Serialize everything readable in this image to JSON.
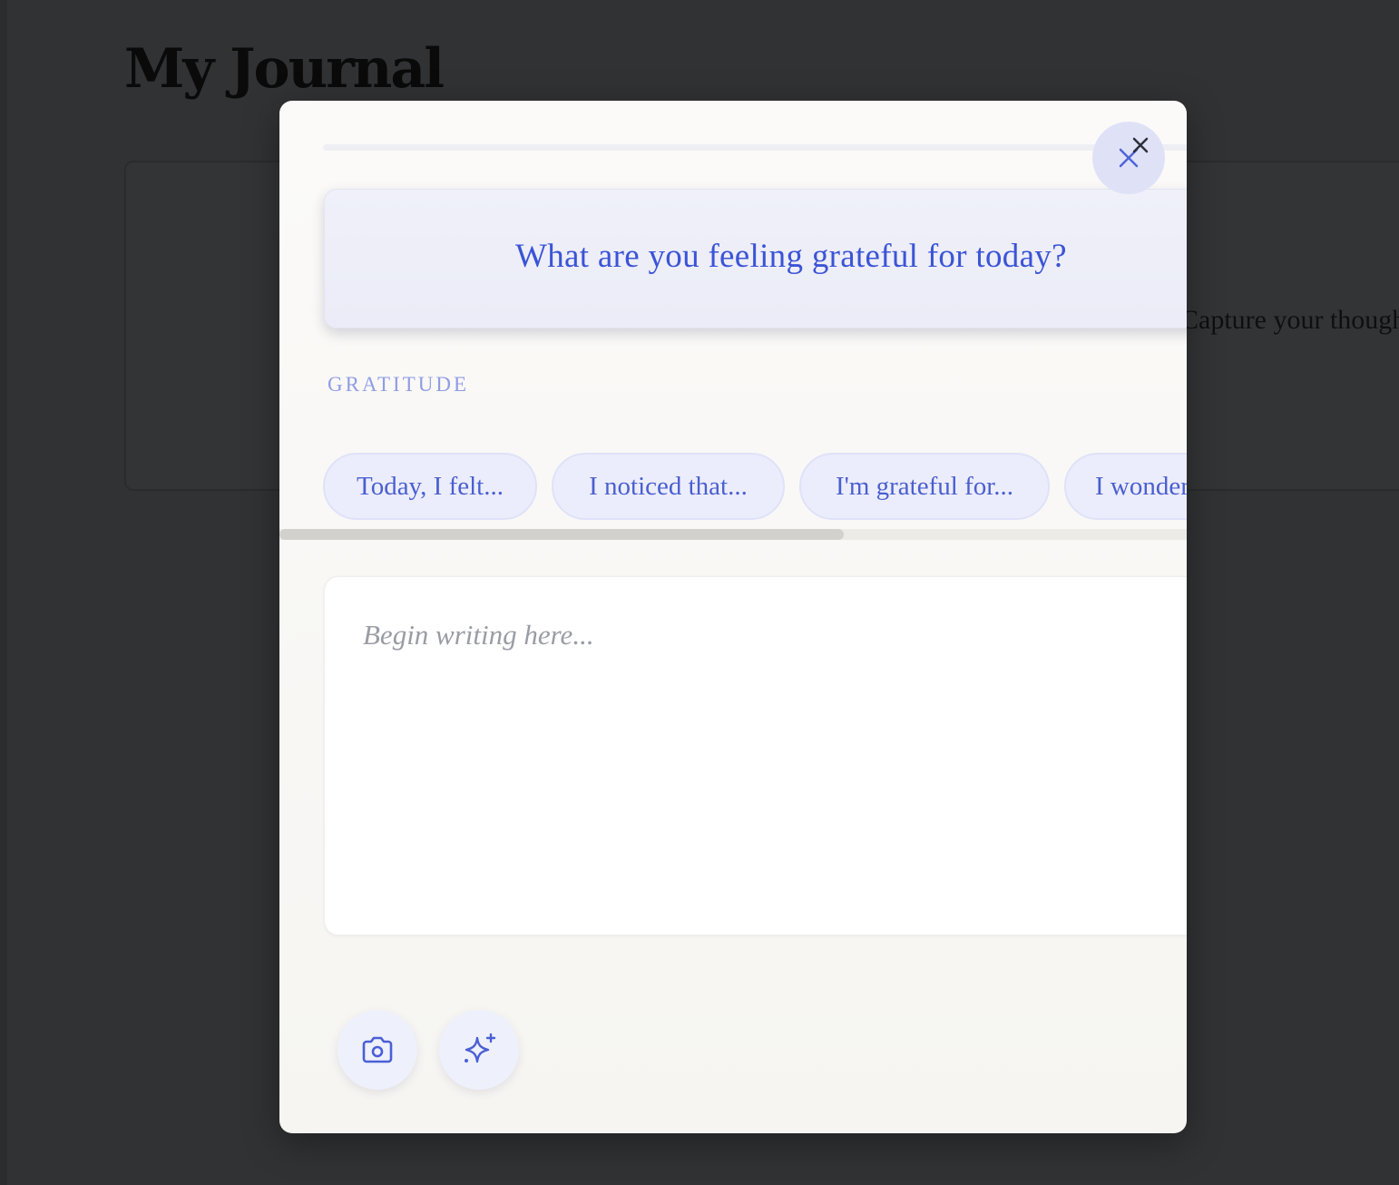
{
  "page": {
    "title": "My Journal",
    "background_card_text": "Capture your thoughts and moods"
  },
  "modal": {
    "prompt": "What are you feeling grateful for today?",
    "category": "GRATITUDE",
    "starter_chips": [
      {
        "label": "Today, I felt..."
      },
      {
        "label": "I noticed that..."
      },
      {
        "label": "I'm grateful for..."
      },
      {
        "label": "I wonder..."
      }
    ],
    "editor": {
      "placeholder": "Begin writing here...",
      "value": ""
    },
    "close_icon": "close-icon",
    "tools": [
      {
        "icon": "camera-icon"
      },
      {
        "icon": "sparkles-icon"
      }
    ]
  },
  "colors": {
    "accent": "#3b54d6",
    "chip_bg": "#ecedfc",
    "overlay": "#313234",
    "modal_bg": "#fbfaf8"
  }
}
